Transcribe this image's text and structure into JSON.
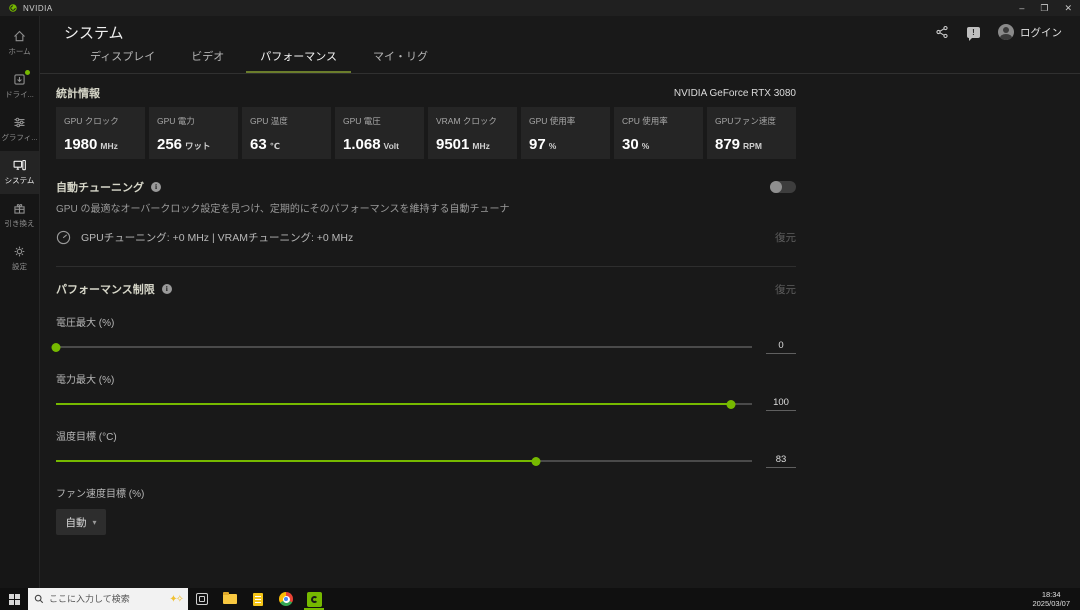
{
  "titlebar": {
    "app_name": "NVIDIA",
    "minimize": "–",
    "restore": "❐",
    "close": "✕"
  },
  "sidebar": {
    "items": [
      {
        "label": "ホーム"
      },
      {
        "label": "ドライ..."
      },
      {
        "label": "グラフィ..."
      },
      {
        "label": "システム"
      },
      {
        "label": "引き換え"
      },
      {
        "label": "設定"
      }
    ]
  },
  "header": {
    "title": "システム",
    "login": "ログイン"
  },
  "tabs": [
    {
      "label": "ディスプレイ"
    },
    {
      "label": "ビデオ"
    },
    {
      "label": "パフォーマンス"
    },
    {
      "label": "マイ・リグ"
    }
  ],
  "stats": {
    "section_title": "統計情報",
    "gpu_name": "NVIDIA GeForce RTX 3080",
    "cards": [
      {
        "label": "GPU クロック",
        "value": "1980",
        "unit": "MHz"
      },
      {
        "label": "GPU 電力",
        "value": "256",
        "unit": "ワット"
      },
      {
        "label": "GPU 温度",
        "value": "63",
        "unit": "℃"
      },
      {
        "label": "GPU 電圧",
        "value": "1.068",
        "unit": "Volt"
      },
      {
        "label": "VRAM クロック",
        "value": "9501",
        "unit": "MHz"
      },
      {
        "label": "GPU 使用率",
        "value": "97",
        "unit": "%"
      },
      {
        "label": "CPU 使用率",
        "value": "30",
        "unit": "%"
      },
      {
        "label": "GPUファン速度",
        "value": "879",
        "unit": "RPM"
      }
    ]
  },
  "auto_tuning": {
    "title": "自動チューニング",
    "description": "GPU の最適なオーバークロック設定を見つけ、定期的にそのパフォーマンスを維持する自動チューナ",
    "status": "GPUチューニング: +0 MHz | VRAMチューニング: +0 MHz",
    "restore": "復元",
    "enabled": false
  },
  "performance_limits": {
    "title": "パフォーマンス制限",
    "restore": "復元",
    "sliders": [
      {
        "label": "電圧最大 (%)",
        "value": "0",
        "percent": 0
      },
      {
        "label": "電力最大 (%)",
        "value": "100",
        "percent": 97
      },
      {
        "label": "温度目標 (°C)",
        "value": "83",
        "percent": 69
      }
    ],
    "fan_label": "ファン速度目標 (%)",
    "fan_value": "自動",
    "caret": "▾"
  },
  "taskbar": {
    "search_placeholder": "ここに入力して検索",
    "time": "18:34",
    "date": "2025/03/07"
  },
  "colors": {
    "accent": "#76b900"
  }
}
